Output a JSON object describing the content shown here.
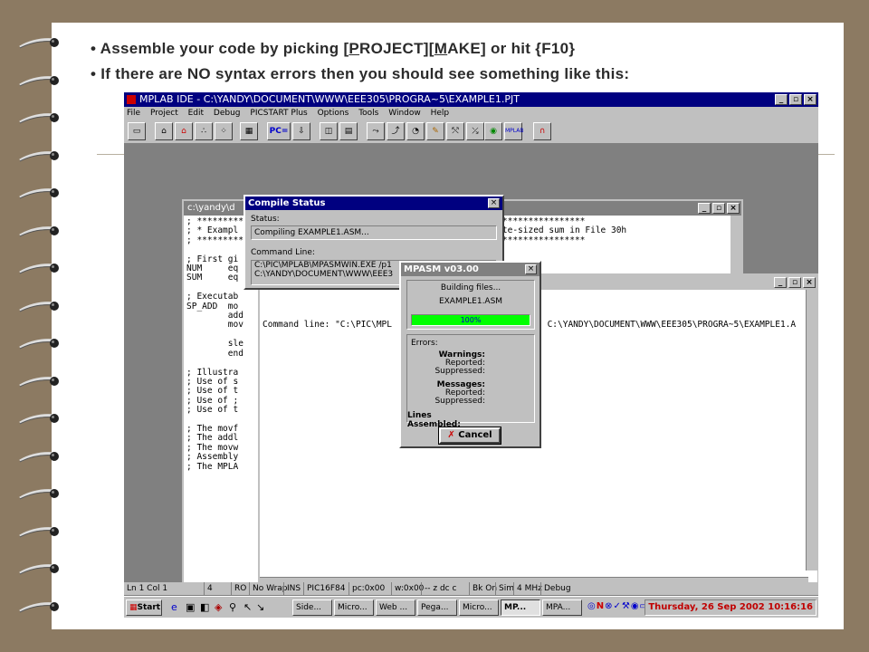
{
  "slide": {
    "bullet1_pre": "• Assemble your code by picking [",
    "bullet1_p": "P",
    "bullet1_mid1": "ROJECT][",
    "bullet1_m": "M",
    "bullet1_post": "AKE] or hit {F10}",
    "bullet2": "• If there are NO syntax errors then you should see something like this:"
  },
  "ide": {
    "title": "MPLAB IDE - C:\\YANDY\\DOCUMENT\\WWW\\EEE305\\PROGRA~5\\EXAMPLE1.PJT",
    "menu": [
      "File",
      "Project",
      "Edit",
      "Debug",
      "PICSTART Plus",
      "Options",
      "Tools",
      "Window",
      "Help"
    ],
    "toolbar": {
      "pc_label": "PC=",
      "mplab_label": "MPLAB"
    },
    "source_title": "c:\\yandy\\d",
    "source_lines": [
      "; ***************************************************************************",
      "; * Exampl                                    M giving the byte-sized sum in File 30h",
      "; ***************************************************************************",
      "",
      "; First gi",
      "NUM     eq",
      "SUM     eq",
      "",
      "; Executab",
      "SP_ADD  mo",
      "        add",
      "        mov",
      "",
      "        sle",
      "        end",
      "",
      "; Illustra",
      "; Use of s",
      "; Use of t",
      "; Use of ;",
      "; Use of t",
      "",
      "; The movf",
      "; The addl",
      "; The movw",
      "; Assembly",
      "; The MPLA"
    ],
    "output_line": "Command line: \"C:\\PIC\\MPL                              C:\\YANDY\\DOCUMENT\\WWW\\EEE305\\PROGRA~5\\EXAMPLE1.A",
    "compile_status": {
      "title": "Compile Status",
      "status_label": "Status:",
      "status_value": "Compiling EXAMPLE1.ASM...",
      "cmd_label": "Command Line:",
      "cmd_line1": "C:\\PIC\\MPLAB\\MPASMWIN.EXE /p1",
      "cmd_line2": "C:\\YANDY\\DOCUMENT\\WWW\\EEE3"
    },
    "mpasm": {
      "title": "MPASM v03.00",
      "building": "Building files...",
      "file": "EXAMPLE1.ASM",
      "progress_text": "100%",
      "progress": 1.0,
      "errors": "Errors:",
      "warnings": "Warnings:",
      "reported": "Reported:",
      "suppressed": "Suppressed:",
      "messages": "Messages:",
      "lines_assembled": "Lines Assembled:",
      "cancel": "Cancel"
    },
    "status_bar": [
      "Ln 1 Col 1",
      "4",
      "RO",
      "No Wrap",
      "INS",
      "PIC16F84",
      "pc:0x00",
      "w:0x00",
      "-- z dc c",
      "Bk On",
      "Sim",
      "4 MHz",
      "Debug"
    ],
    "taskbar": {
      "start": "Start",
      "tasks": [
        "Side...",
        "Micro...",
        "Web ...",
        "Pega...",
        "Micro...",
        "MP...",
        "MPA..."
      ],
      "clock": "Thursday, 26 Sep 2002 10:16:16"
    }
  }
}
